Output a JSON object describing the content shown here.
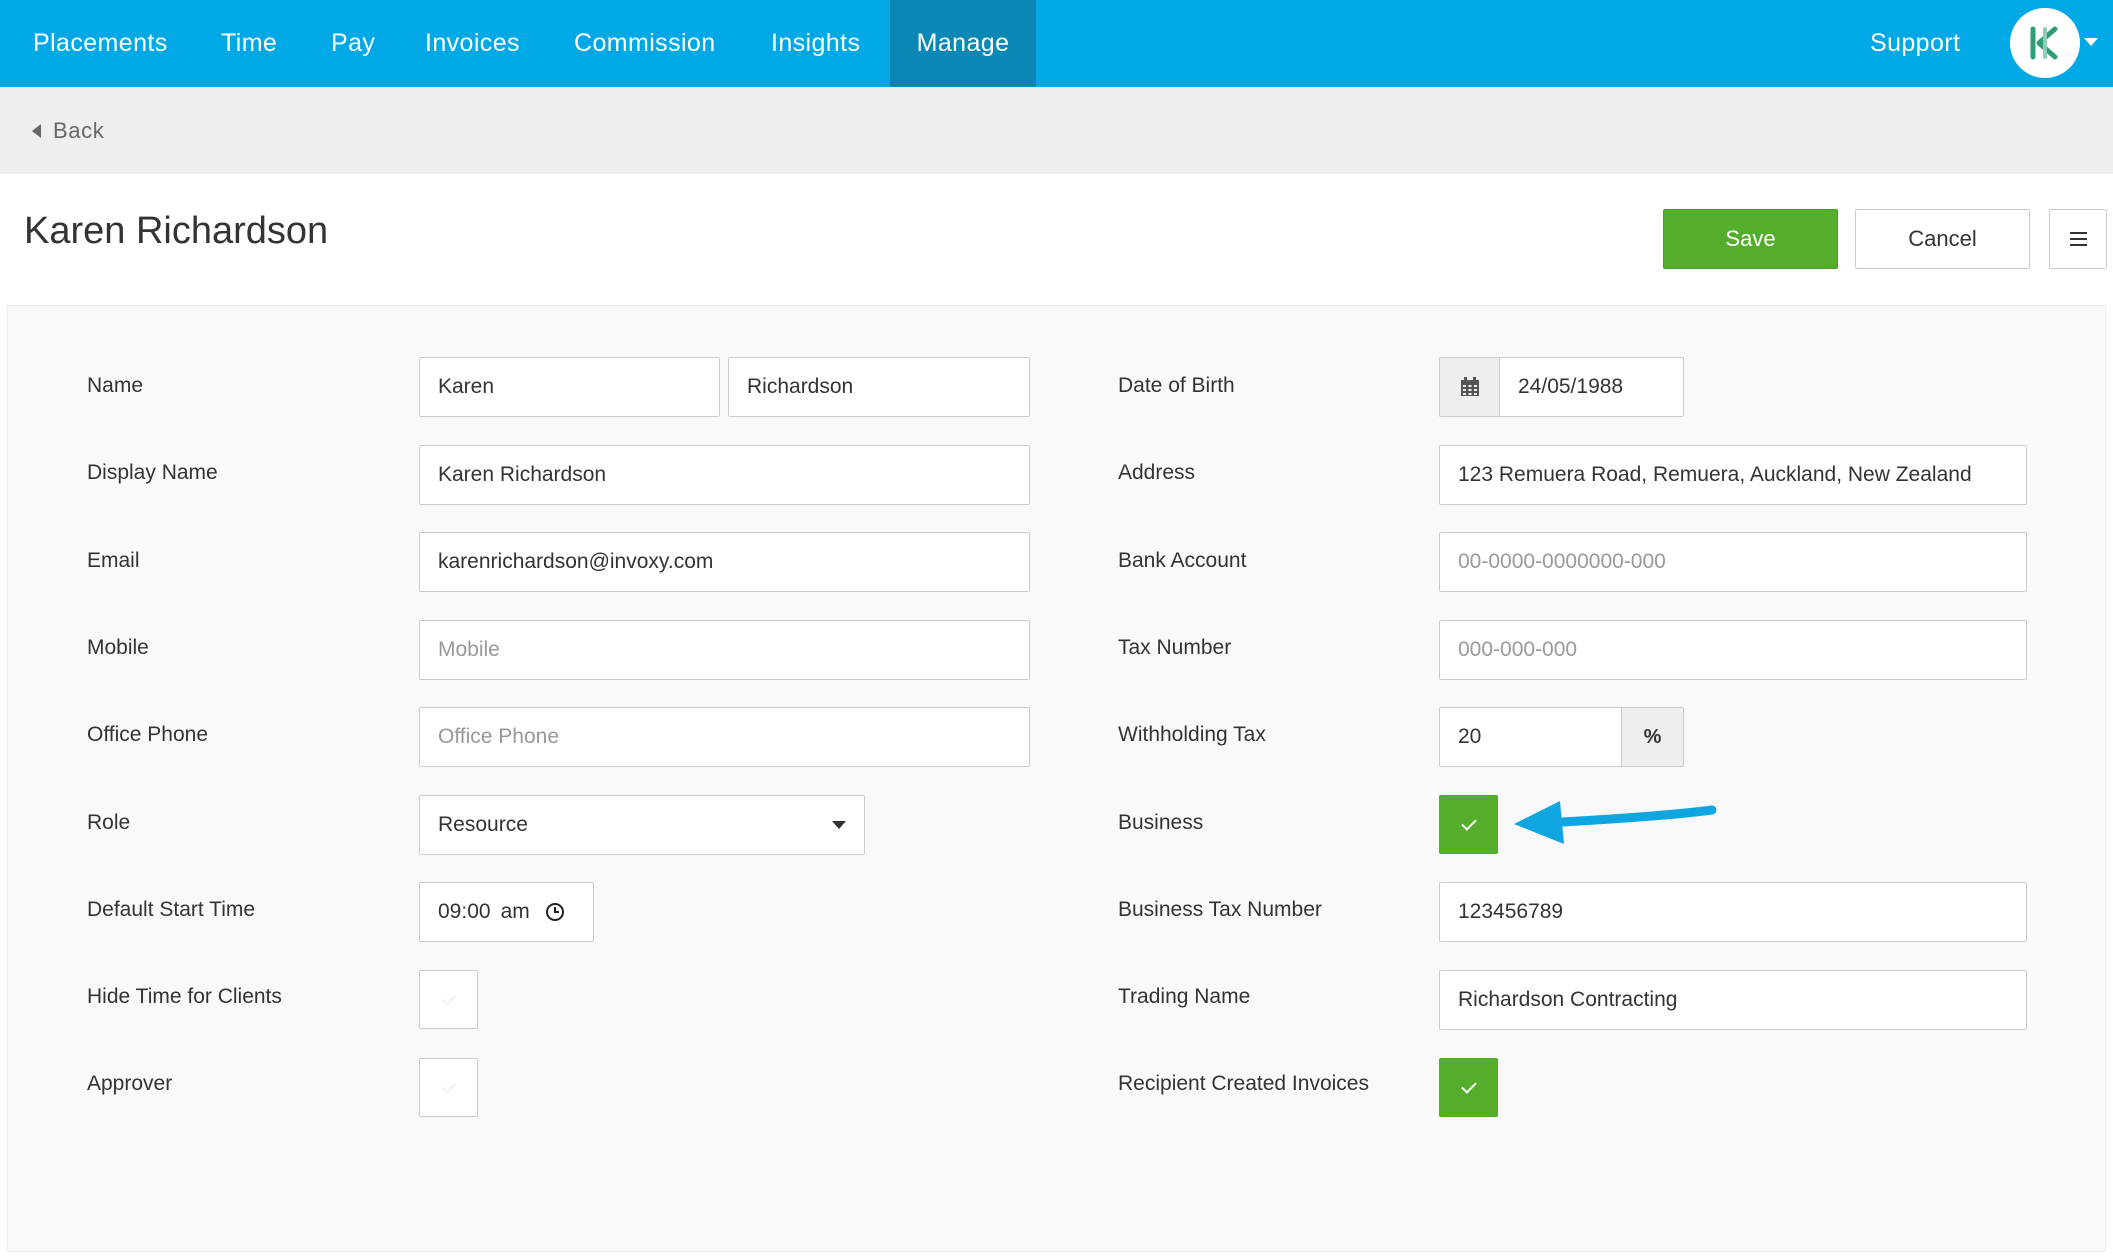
{
  "nav": {
    "items": [
      "Placements",
      "Time",
      "Pay",
      "Invoices",
      "Commission",
      "Insights",
      "Manage"
    ],
    "active": "Manage",
    "support": "Support"
  },
  "subheader": {
    "back_label": "Back"
  },
  "page": {
    "title": "Karen Richardson"
  },
  "actions": {
    "save": "Save",
    "cancel": "Cancel"
  },
  "form_left": {
    "name": {
      "label": "Name",
      "first": "Karen",
      "last": "Richardson"
    },
    "display_name": {
      "label": "Display Name",
      "value": "Karen Richardson"
    },
    "email": {
      "label": "Email",
      "value": "karenrichardson@invoxy.com"
    },
    "mobile": {
      "label": "Mobile",
      "placeholder": "Mobile",
      "value": ""
    },
    "office_phone": {
      "label": "Office Phone",
      "placeholder": "Office Phone",
      "value": ""
    },
    "role": {
      "label": "Role",
      "value": "Resource"
    },
    "default_start_time": {
      "label": "Default Start Time",
      "hour": "09",
      "minute": "00",
      "period": "am"
    },
    "hide_time": {
      "label": "Hide Time for Clients",
      "checked": false
    },
    "approver": {
      "label": "Approver",
      "checked": false
    }
  },
  "form_right": {
    "dob": {
      "label": "Date of Birth",
      "value": "24/05/1988"
    },
    "address": {
      "label": "Address",
      "value": "123 Remuera Road, Remuera, Auckland, New Zealand"
    },
    "bank_account": {
      "label": "Bank Account",
      "placeholder": "00-0000-0000000-000",
      "value": ""
    },
    "tax_number": {
      "label": "Tax Number",
      "placeholder": "000-000-000",
      "value": ""
    },
    "withholding_tax": {
      "label": "Withholding Tax",
      "value": "20",
      "unit": "%"
    },
    "business": {
      "label": "Business",
      "checked": true
    },
    "business_tax_number": {
      "label": "Business Tax Number",
      "value": "123456789"
    },
    "trading_name": {
      "label": "Trading Name",
      "value": "Richardson Contracting"
    },
    "rci": {
      "label": "Recipient Created Invoices",
      "checked": true
    }
  },
  "colors": {
    "nav_bg": "#00a9e6",
    "nav_active": "#0a87b5",
    "save_green": "#55ae2b",
    "checked_green": "#55ae2b",
    "annotation_arrow": "#0ea5e0",
    "logo_green": "#2e9e7a"
  },
  "icons": {
    "avatar": "company-logo-icon",
    "back": "caret-left-icon",
    "menu": "hamburger-icon",
    "date": "calendar-icon",
    "time": "clock-icon",
    "check": "check-icon"
  }
}
